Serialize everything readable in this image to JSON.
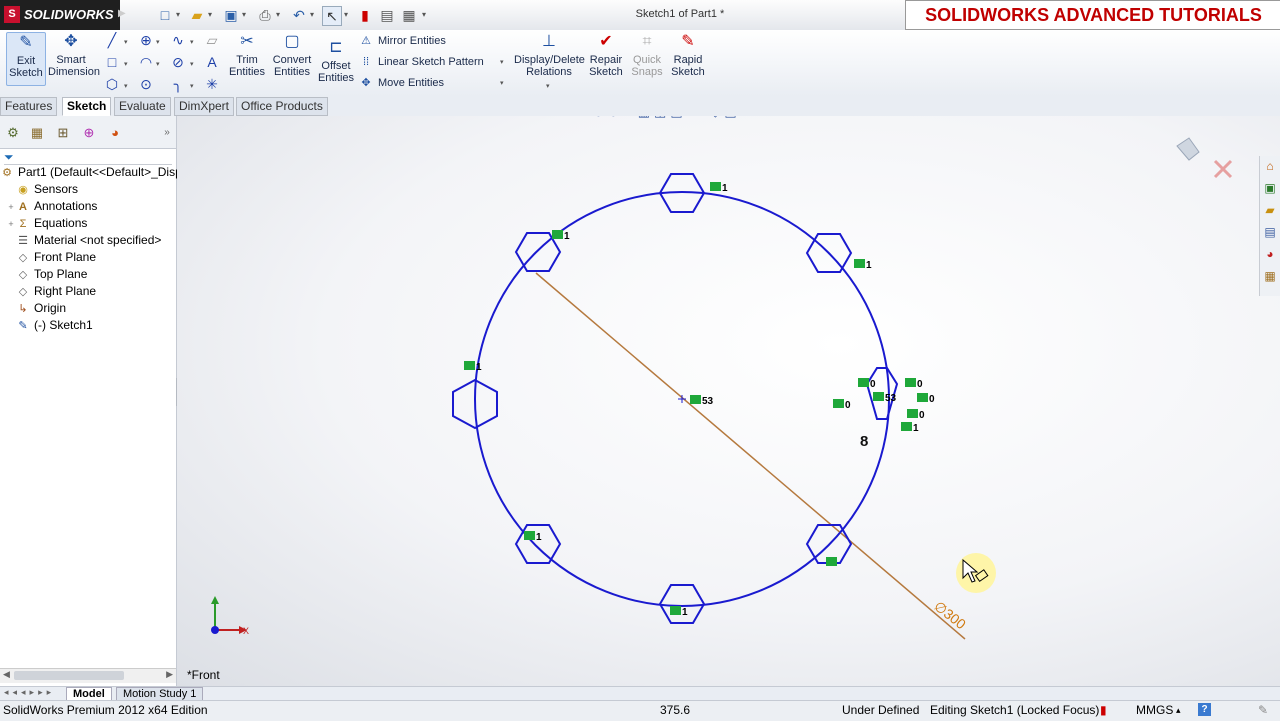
{
  "app": {
    "logo_text": "SOLIDWORKS",
    "document_title": "Sketch1 of Part1 *",
    "banner": "SOLIDWORKS ADVANCED TUTORIALS"
  },
  "command_manager": {
    "exit_sketch": "Exit Sketch",
    "smart_dimension": "Smart Dimension",
    "trim_entities": "Trim Entities",
    "convert_entities": "Convert Entities",
    "offset_entities": "Offset Entities",
    "mirror_entities": "Mirror Entities",
    "linear_sketch_pattern": "Linear Sketch Pattern",
    "move_entities": "Move Entities",
    "display_delete_relations": "Display/Delete Relations",
    "repair_sketch": "Repair Sketch",
    "quick_snaps": "Quick Snaps",
    "rapid_sketch": "Rapid Sketch"
  },
  "tabs": [
    "Features",
    "Sketch",
    "Evaluate",
    "DimXpert",
    "Office Products"
  ],
  "active_tab": "Sketch",
  "feature_tree": {
    "root": "Part1  (Default<<Default>_Disp",
    "items": [
      {
        "label": "Sensors",
        "icon": "sensor-icon"
      },
      {
        "label": "Annotations",
        "icon": "annotation-icon"
      },
      {
        "label": "Equations",
        "icon": "equation-icon"
      },
      {
        "label": "Material <not specified>",
        "icon": "material-icon"
      },
      {
        "label": "Front Plane",
        "icon": "plane-icon"
      },
      {
        "label": "Top Plane",
        "icon": "plane-icon"
      },
      {
        "label": "Right Plane",
        "icon": "plane-icon"
      },
      {
        "label": "Origin",
        "icon": "origin-icon"
      },
      {
        "label": "(-) Sketch1",
        "icon": "sketch-icon"
      }
    ]
  },
  "viewport": {
    "view_name": "*Front",
    "diameter_label": "∅300",
    "pattern_count": "8",
    "relation_center": "53",
    "relation_tag": "1",
    "relation_zero": "0",
    "axis_x": "X"
  },
  "bottom_tabs": [
    "Model",
    "Motion Study 1"
  ],
  "status": {
    "edition": "SolidWorks Premium 2012 x64 Edition",
    "coordinate": "375.6",
    "state": "Under Defined",
    "editing": "Editing Sketch1 (Locked Focus)",
    "units": "MMGS"
  },
  "colors": {
    "sketch_line": "#1a1acf",
    "construction_line": "#b5793e",
    "relation_badge": "#1fa83a",
    "banner_text": "#c00000"
  }
}
